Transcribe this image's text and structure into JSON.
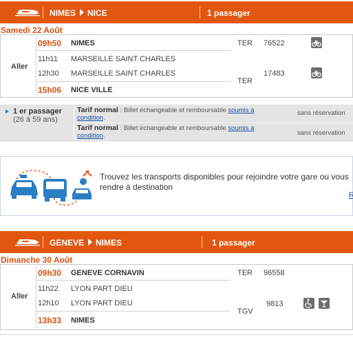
{
  "journey1": {
    "origin": "NIMES",
    "destination": "NICE",
    "passengers": "1  passager",
    "date": "Samedi 22 Août",
    "direction": "Aller",
    "stops": [
      {
        "time": "09h50",
        "station": "NIMES"
      },
      {
        "time": "11h11",
        "station": "MARSEILLE SAINT CHARLES"
      },
      {
        "time": "12h30",
        "station": "MARSEILLE SAINT CHARLES"
      },
      {
        "time": "15h06",
        "station": "NICE VILLE"
      }
    ],
    "legs": [
      {
        "type": "TER",
        "number": "76522",
        "icon": "bicycle-icon"
      },
      {
        "type": "TER",
        "number": "17483",
        "icon": "bicycle-icon"
      }
    ]
  },
  "fares": {
    "passenger_label": "1 er passager",
    "passenger_age": "(26 à 59 ans)",
    "rows": [
      {
        "name": "Tarif normal",
        "text": " : Billet échangeable et remboursable ",
        "link": "soumis à condition",
        "end": ".",
        "reservation": "sans réservation"
      },
      {
        "name": "Tarif normal",
        "text": " : Billet échangeable et remboursable ",
        "link": "soumis à condition",
        "end": ".",
        "reservation": "sans réservation"
      }
    ]
  },
  "promo": {
    "text": "Trouvez les transports disponibles pour rejoindre votre gare ou vous rendre à destination",
    "link": "R"
  },
  "journey2": {
    "origin": "GENEVE",
    "destination": "NIMES",
    "passengers": "1  passager",
    "date": "Dimanche 30 Août",
    "direction": "Aller",
    "stops": [
      {
        "time": "09h30",
        "station": "GENEVE CORNAVIN"
      },
      {
        "time": "11h22",
        "station": "LYON PART DIEU"
      },
      {
        "time": "12h10",
        "station": "LYON PART DIEU"
      },
      {
        "time": "13h33",
        "station": "NIMES"
      }
    ],
    "legs": [
      {
        "type": "TER",
        "number": "96558",
        "icon": ""
      },
      {
        "type": "TGV",
        "number": "9813",
        "icon": "wheelchair-icon"
      }
    ]
  },
  "colors": {
    "brand": "#e2570f",
    "accent_text": "#d9520d",
    "link": "#1a4fa0"
  }
}
